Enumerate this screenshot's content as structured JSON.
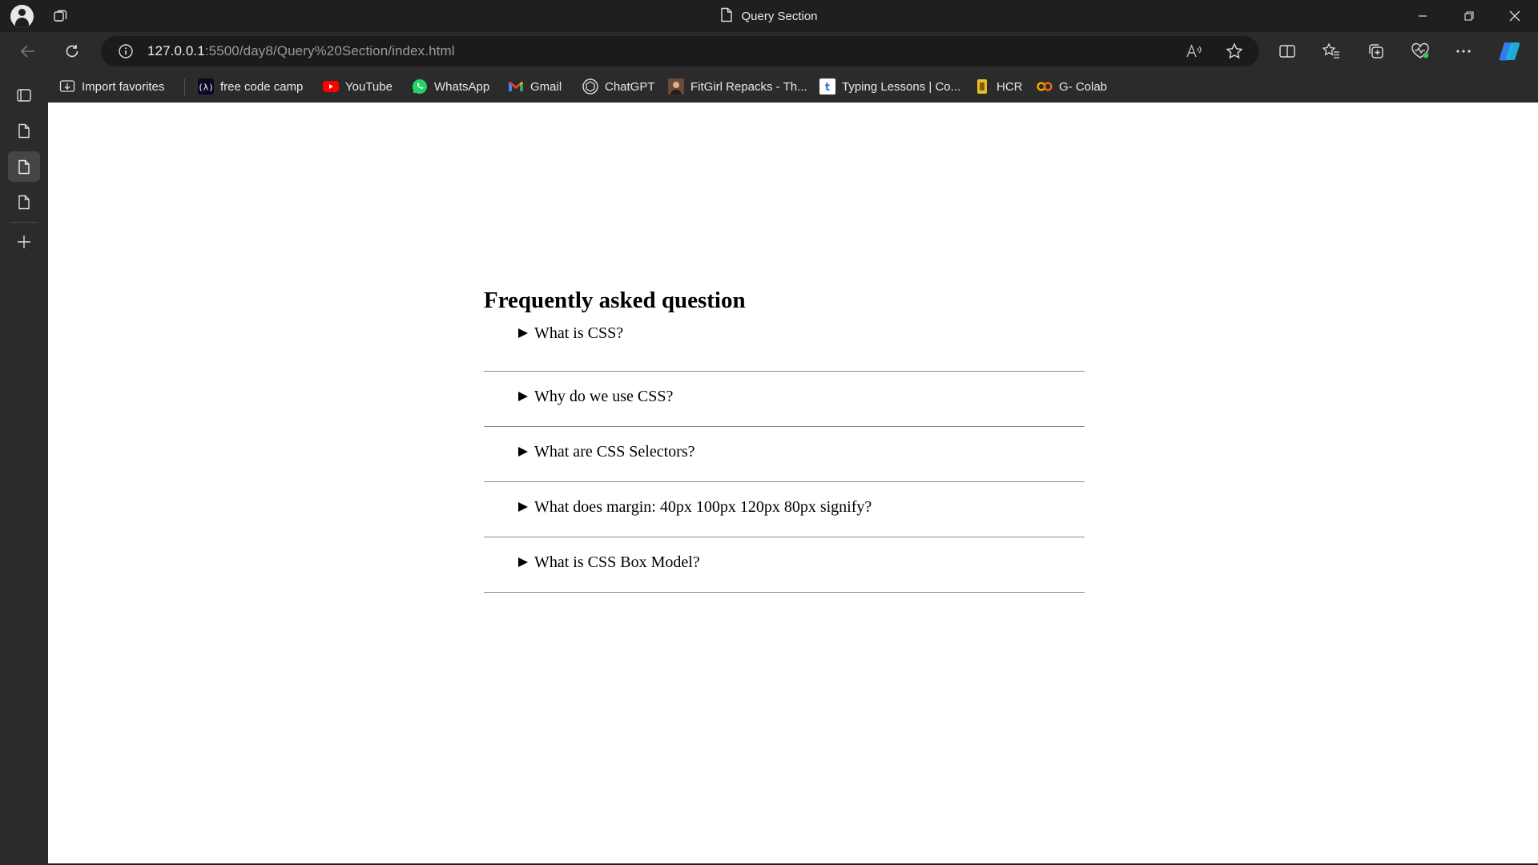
{
  "browser": {
    "tab_title": "Query Section",
    "url_host": "127.0.0.1",
    "url_rest": ":5500/day8/Query%20Section/index.html"
  },
  "favorites": [
    {
      "label": "Import favorites",
      "icon": "import-favorites-icon"
    },
    {
      "label": "free code camp",
      "icon": "freecodecamp-icon"
    },
    {
      "label": "YouTube",
      "icon": "youtube-icon"
    },
    {
      "label": "WhatsApp",
      "icon": "whatsapp-icon"
    },
    {
      "label": "Gmail",
      "icon": "gmail-icon"
    },
    {
      "label": "ChatGPT",
      "icon": "chatgpt-icon"
    },
    {
      "label": "FitGirl Repacks - Th...",
      "icon": "fitgirl-icon"
    },
    {
      "label": "Typing Lessons | Co...",
      "icon": "typing-icon"
    },
    {
      "label": "HCR",
      "icon": "hcr-icon"
    },
    {
      "label": "G- Colab",
      "icon": "colab-icon"
    }
  ],
  "page": {
    "heading": "Frequently asked question",
    "questions": [
      "What is CSS?",
      "Why do we use CSS?",
      "What are CSS Selectors?",
      "What does margin: 40px 100px 120px 80px signify?",
      "What is CSS Box Model?"
    ]
  },
  "colors": {
    "chrome_bg": "#2b2b2b",
    "titlebar_bg": "#1f1f1f",
    "page_bg": "#ffffff",
    "divider": "#8a8a8a"
  }
}
